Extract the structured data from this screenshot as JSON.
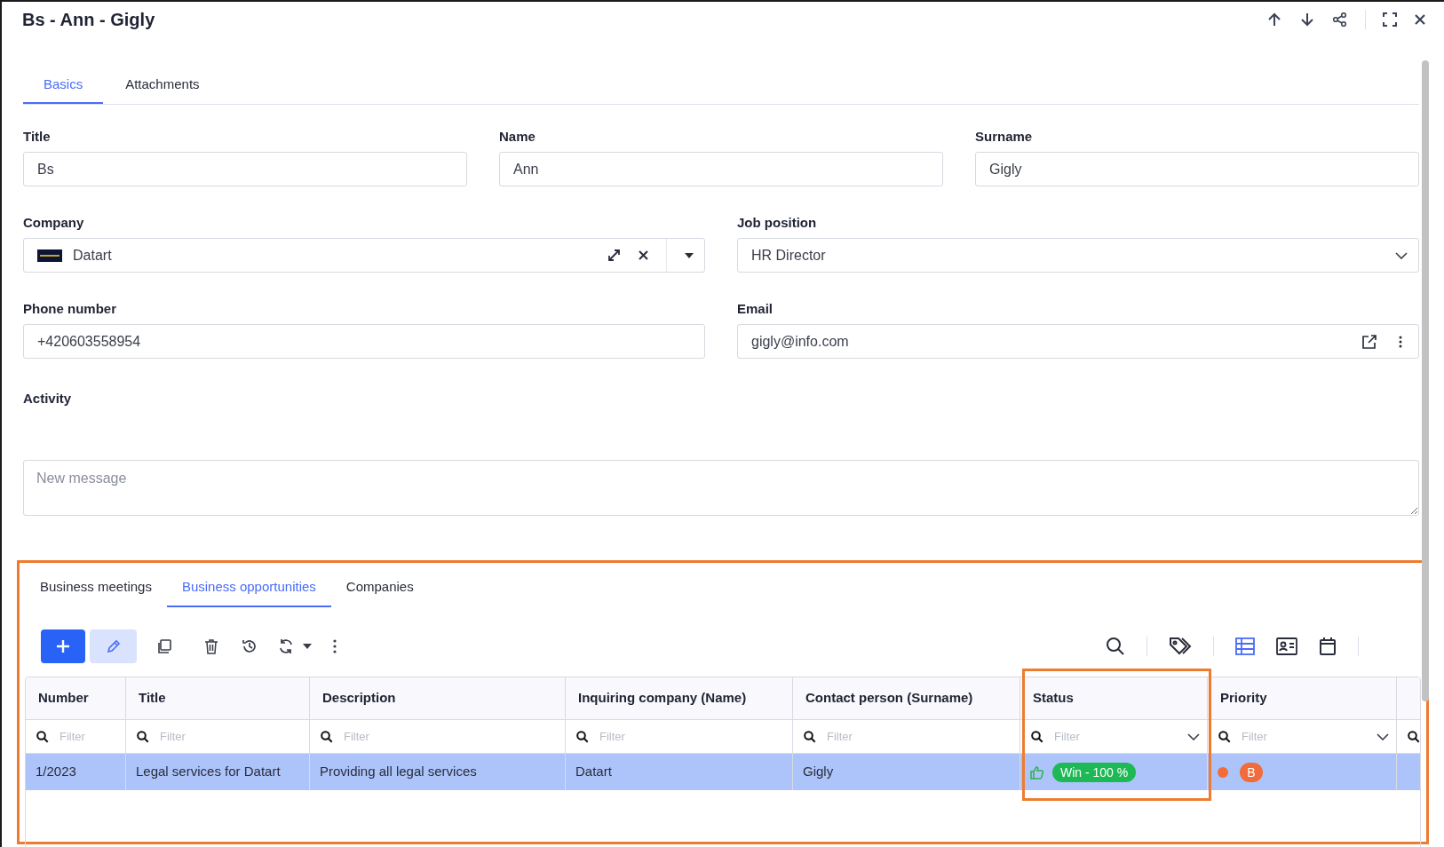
{
  "window": {
    "title": "Bs - Ann - Gigly"
  },
  "tabs": [
    {
      "label": "Basics",
      "selected": true
    },
    {
      "label": "Attachments",
      "selected": false
    }
  ],
  "field_rows": [
    [
      {
        "kind": "text",
        "label": "Title",
        "value": "Bs"
      },
      {
        "kind": "text",
        "label": "Name",
        "value": "Ann"
      },
      {
        "kind": "text",
        "label": "Surname",
        "value": "Gigly"
      }
    ],
    [
      {
        "kind": "lookup",
        "label": "Company",
        "value": "Datart"
      },
      {
        "kind": "select",
        "label": "Job position",
        "value": "HR Director"
      }
    ],
    [
      {
        "kind": "text",
        "label": "Phone number",
        "value": "+420603558954"
      },
      {
        "kind": "email",
        "label": "Email",
        "value": "gigly@info.com"
      }
    ]
  ],
  "activity": {
    "label": "Activity",
    "placeholder": "New message"
  },
  "related": {
    "tabs": [
      {
        "label": "Business meetings",
        "selected": false
      },
      {
        "label": "Business opportunities",
        "selected": true
      },
      {
        "label": "Companies",
        "selected": false
      }
    ],
    "table": {
      "columns": [
        {
          "label": "Number",
          "filter_placeholder": "Filter",
          "dropdown": false
        },
        {
          "label": "Title",
          "filter_placeholder": "Filter",
          "dropdown": false
        },
        {
          "label": "Description",
          "filter_placeholder": "Filter",
          "dropdown": false
        },
        {
          "label": "Inquiring company (Name)",
          "filter_placeholder": "Filter",
          "dropdown": false
        },
        {
          "label": "Contact person (Surname)",
          "filter_placeholder": "Filter",
          "dropdown": false
        },
        {
          "label": "Status",
          "filter_placeholder": "Filter",
          "dropdown": true
        },
        {
          "label": "Priority",
          "filter_placeholder": "Filter",
          "dropdown": true
        }
      ],
      "rows": [
        {
          "selected": true,
          "cells": [
            {
              "kind": "text",
              "text": "1/2023"
            },
            {
              "kind": "text",
              "text": "Legal services for Datart"
            },
            {
              "kind": "text",
              "text": "Providing all legal services"
            },
            {
              "kind": "text",
              "text": "Datart"
            },
            {
              "kind": "text",
              "text": "Gigly"
            },
            {
              "kind": "status",
              "text": "Win - 100 %",
              "color": "#1db954"
            },
            {
              "kind": "priority",
              "text": "B",
              "color": "#f26b3a"
            }
          ]
        }
      ]
    }
  }
}
